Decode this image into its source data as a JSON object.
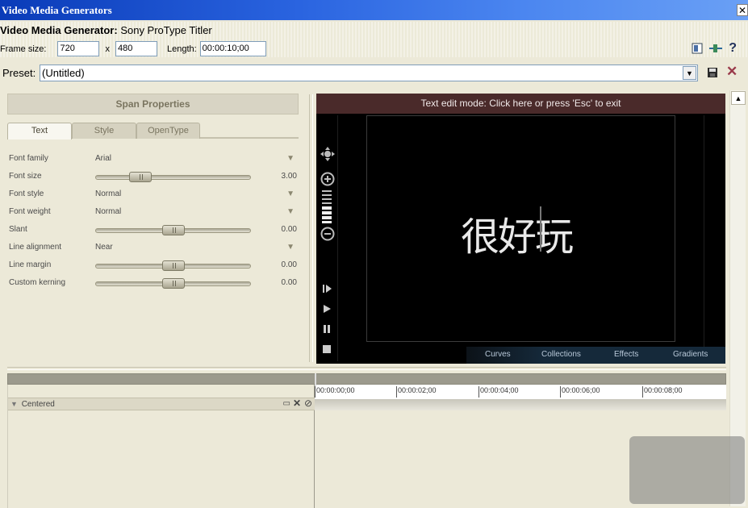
{
  "window": {
    "title": "Video Media Generators",
    "close_glyph": "✕"
  },
  "generator": {
    "prefix": "Video Media Generator:",
    "name": "Sony ProType Titler"
  },
  "frame": {
    "label": "Frame size:",
    "width": "720",
    "x": "x",
    "height": "480",
    "length_label": "Length:",
    "length": "00:00:10;00"
  },
  "preset": {
    "label": "Preset:",
    "value": "(Untitled)"
  },
  "span": {
    "header": "Span Properties",
    "tabs": [
      "Text",
      "Style",
      "OpenType"
    ],
    "active_tab": "Text",
    "props": [
      {
        "label": "Font family",
        "type": "dropdown",
        "value": "Arial"
      },
      {
        "label": "Font size",
        "type": "slider",
        "value": "3.00",
        "level": 0.29
      },
      {
        "label": "Font style",
        "type": "dropdown",
        "value": "Normal"
      },
      {
        "label": "Font weight",
        "type": "dropdown",
        "value": "Normal"
      },
      {
        "label": "Slant",
        "type": "slider",
        "value": "0.00",
        "level": 0.5
      },
      {
        "label": "Line alignment",
        "type": "dropdown",
        "value": "Near"
      },
      {
        "label": "Line margin",
        "type": "slider",
        "value": "0.00",
        "level": 0.5
      },
      {
        "label": "Custom kerning",
        "type": "slider",
        "value": "0.00",
        "level": 0.5
      }
    ]
  },
  "preview": {
    "edit_banner": "Text edit mode: Click here or press 'Esc' to exit",
    "canvas_text": "很好玩",
    "bottom_tabs": [
      "Curves",
      "Collections",
      "Effects",
      "Gradients"
    ]
  },
  "timeline": {
    "track_name": "Centered",
    "ticks": [
      "00:00:00;00",
      "00:00:02;00",
      "00:00:04;00",
      "00:00:06;00",
      "00:00:08;00"
    ]
  },
  "colors": {
    "titlebar": "#2a64e0",
    "edit_banner": "#4a2a2a",
    "preview_bg": "#000000",
    "panel_bg": "#ece9d8"
  },
  "icons": [
    "close-icon",
    "properties-icon",
    "plugin-icon",
    "help-icon",
    "dropdown-arrow-icon",
    "save-preset-icon",
    "delete-preset-icon",
    "move-icon",
    "zoom-in-icon",
    "zoom-out-icon",
    "go-to-start-icon",
    "play-icon",
    "pause-icon",
    "stop-icon"
  ]
}
